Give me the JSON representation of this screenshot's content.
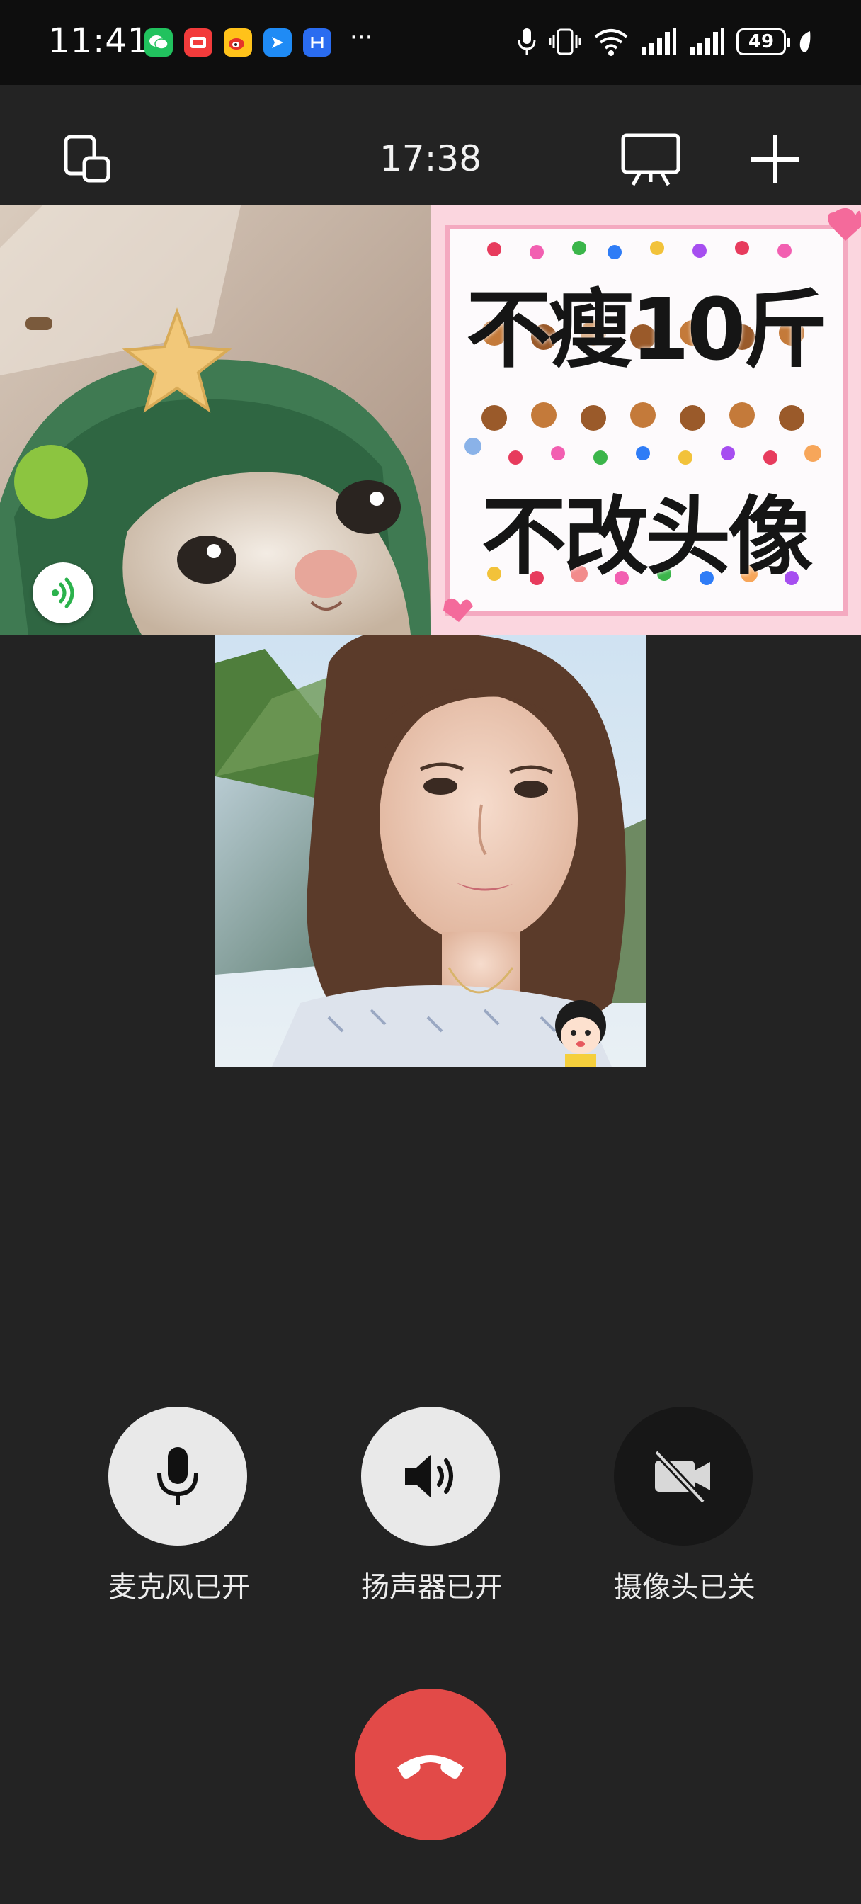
{
  "status_bar": {
    "time": "11:41",
    "more": "···",
    "battery": "49",
    "app_icons": [
      "wechat-icon",
      "red-book-icon",
      "weibo-icon",
      "paper-plane-app-icon",
      "h-app-icon"
    ]
  },
  "toolbar": {
    "call_duration": "17:38"
  },
  "participants": {
    "tile_meme": {
      "line1": "不瘦10斤",
      "line2": "不改头像"
    }
  },
  "controls": {
    "microphone_label": "麦克风已开",
    "speaker_label": "扬声器已开",
    "camera_label": "摄像头已关"
  },
  "colors": {
    "background": "#232323",
    "hangup": "#e24a48",
    "active_button": "#e9e9e9",
    "inactive_button": "#171717",
    "audio_indicator": "#2bb24c"
  }
}
